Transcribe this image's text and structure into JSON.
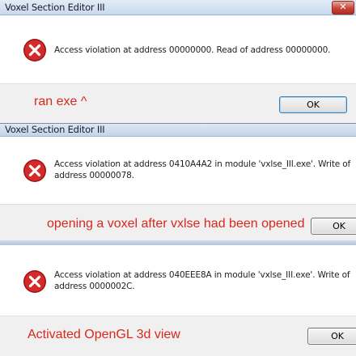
{
  "dialogs": [
    {
      "title": "Voxel Section Editor III",
      "close_glyph": "✕",
      "message_line1": "Access violation at address 00000000. Read of address 00000000.",
      "message_line2": "",
      "annotation": "ran exe ^",
      "ok_label": "OK"
    },
    {
      "title": "Voxel Section Editor III",
      "message_line1": "Access violation at address 0410A4A2 in module 'vxlse_III.exe'. Write of",
      "message_line2": "address 00000078.",
      "annotation": "opening a voxel after vxlse had been opened",
      "ok_label": "OK"
    },
    {
      "title": "",
      "message_line1": "Access violation at address 040EEE8A in module 'vxlse_III.exe'. Write of",
      "message_line2": "address 0000002C.",
      "annotation": "Activated OpenGL 3d view",
      "ok_label": "OK"
    }
  ],
  "icon": "error-x-icon",
  "colors": {
    "annotation": "#d9281c",
    "error_icon": "#c81e1e"
  }
}
